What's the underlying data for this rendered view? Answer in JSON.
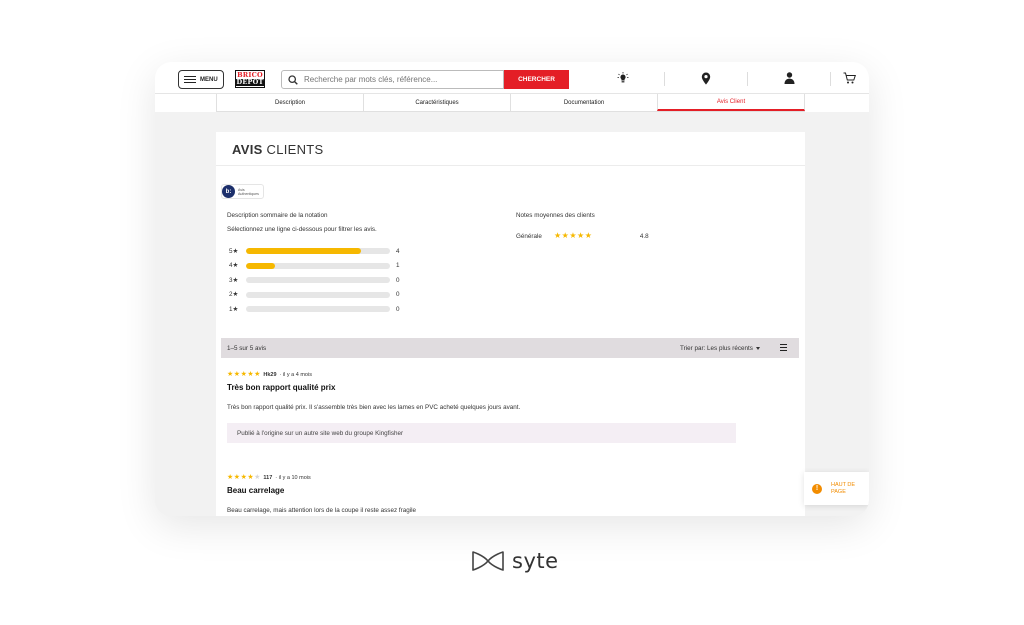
{
  "header": {
    "menu_label": "MENU",
    "logo_line1": "BRICO",
    "logo_line2": "DEPOT",
    "search_placeholder": "Recherche par mots clés, référence...",
    "search_button": "CHERCHER",
    "icons": [
      "idea-icon",
      "location-icon",
      "user-icon",
      "cart-icon"
    ]
  },
  "tabs": [
    {
      "label": "Description",
      "active": false
    },
    {
      "label": "Caractéristiques",
      "active": false
    },
    {
      "label": "Documentation",
      "active": false
    },
    {
      "label": "Avis Client",
      "active": true
    }
  ],
  "reviews_panel": {
    "title_bold": "AVIS",
    "title_rest": "CLIENTS",
    "badge_logo": "b:",
    "badge_line1": "Avis",
    "badge_line2": "Authentiques",
    "summary_title": "Description sommaire de la notation",
    "summary_subtitle": "Sélectionnez une ligne ci-dessous pour filtrer les avis.",
    "average_title": "Notes moyennes des clients",
    "average_label": "Générale",
    "average_value": "4.8",
    "average_rating": 4.8,
    "histogram": [
      {
        "label": "5★",
        "count": "4",
        "fraction": 0.8
      },
      {
        "label": "4★",
        "count": "1",
        "fraction": 0.2
      },
      {
        "label": "3★",
        "count": "0",
        "fraction": 0
      },
      {
        "label": "2★",
        "count": "0",
        "fraction": 0
      },
      {
        "label": "1★",
        "count": "0",
        "fraction": 0
      }
    ],
    "count_text": "1–5 sur 5 avis",
    "sort_text": "Trier par: Les plus récents"
  },
  "reviews": [
    {
      "rating": 5,
      "author": "Hk29",
      "date": "· il y a 4 mois",
      "title": "Très bon rapport qualité prix",
      "body": "Très bon rapport qualité prix. Il s'assemble très bien avec les lames en PVC acheté quelques jours avant.",
      "note": "Publié à l'origine sur un autre site web du groupe Kingfisher"
    },
    {
      "rating": 4,
      "author": "117",
      "date": "· il y a 10 mois",
      "title": "Beau carrelage",
      "body": "Beau carrelage, mais attention lors de la coupe il reste assez fragile"
    }
  ],
  "back_to_top": {
    "icon": "!",
    "label": "HAUT DE PAGE"
  },
  "colors": {
    "accent_red": "#e41e26",
    "star_yellow": "#f6b800",
    "back_top_orange": "#f28c00"
  },
  "brand": {
    "name": "syte"
  }
}
